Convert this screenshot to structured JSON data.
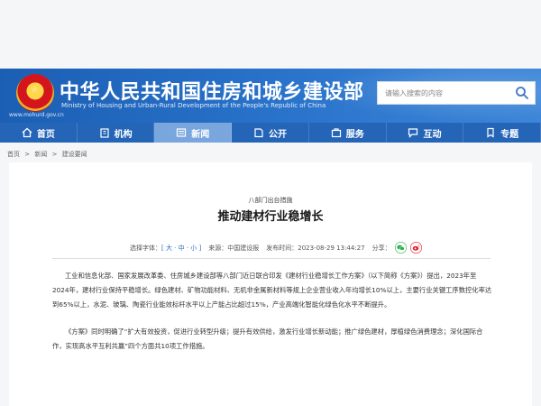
{
  "site": {
    "name_cn": "中华人民共和国住房和城乡建设部",
    "name_en": "Ministry of Housing and Urban-Rural Development of the People's Republic of China",
    "url": "www.mohurd.gov.cn"
  },
  "search": {
    "placeholder": "请输入搜索的内容"
  },
  "nav": {
    "items": [
      {
        "label": "首页",
        "icon": "home-icon"
      },
      {
        "label": "机构",
        "icon": "building-icon"
      },
      {
        "label": "新闻",
        "icon": "news-icon"
      },
      {
        "label": "公开",
        "icon": "open-icon"
      },
      {
        "label": "服务",
        "icon": "service-icon"
      },
      {
        "label": "互动",
        "icon": "chat-icon"
      },
      {
        "label": "专题",
        "icon": "topic-icon"
      }
    ],
    "active": "新闻"
  },
  "breadcrumb": {
    "home": "首页",
    "sep": ">",
    "section": "新闻",
    "page": "建设要闻"
  },
  "article": {
    "kicker": "八部门出台措施",
    "title": "推动建材行业稳增长",
    "meta": {
      "font_label": "选择字体：",
      "font_sizes": "[ 大 · 中 · 小 ]",
      "source": "来源：中国建设报",
      "time": "发布时间：2023-08-29 13:44:27",
      "share_label": "分享："
    },
    "paragraphs": [
      "工业和信息化部、国家发展改革委、住房城乡建设部等八部门近日联合印发《建材行业稳增长工作方案》（以下简称《方案》）提出，2023年至2024年，建材行业保持平稳增长。绿色建材、矿物功能材料、无机非金属新材料等规上企业营业收入年均增长10%以上，主要行业关键工序数控化率达到65%以上，水泥、玻璃、陶瓷行业能效标杆水平以上产能占比超过15%，产业高端化智能化绿色化水平不断提升。",
      "《方案》同时明确了“扩大有效投资，促进行业转型升级；提升有效供给，激发行业增长新动能；推广绿色建材，厚植绿色消费理念；深化国际合作，实现高水平互利共赢”四个方面共10项工作措施。"
    ]
  },
  "colors": {
    "header_blue": "#1b5fb4",
    "nav_blue": "#2565b8",
    "nav_active": "#7aa6de",
    "wechat_green": "#2bb24c",
    "weibo_red": "#e6162d"
  }
}
